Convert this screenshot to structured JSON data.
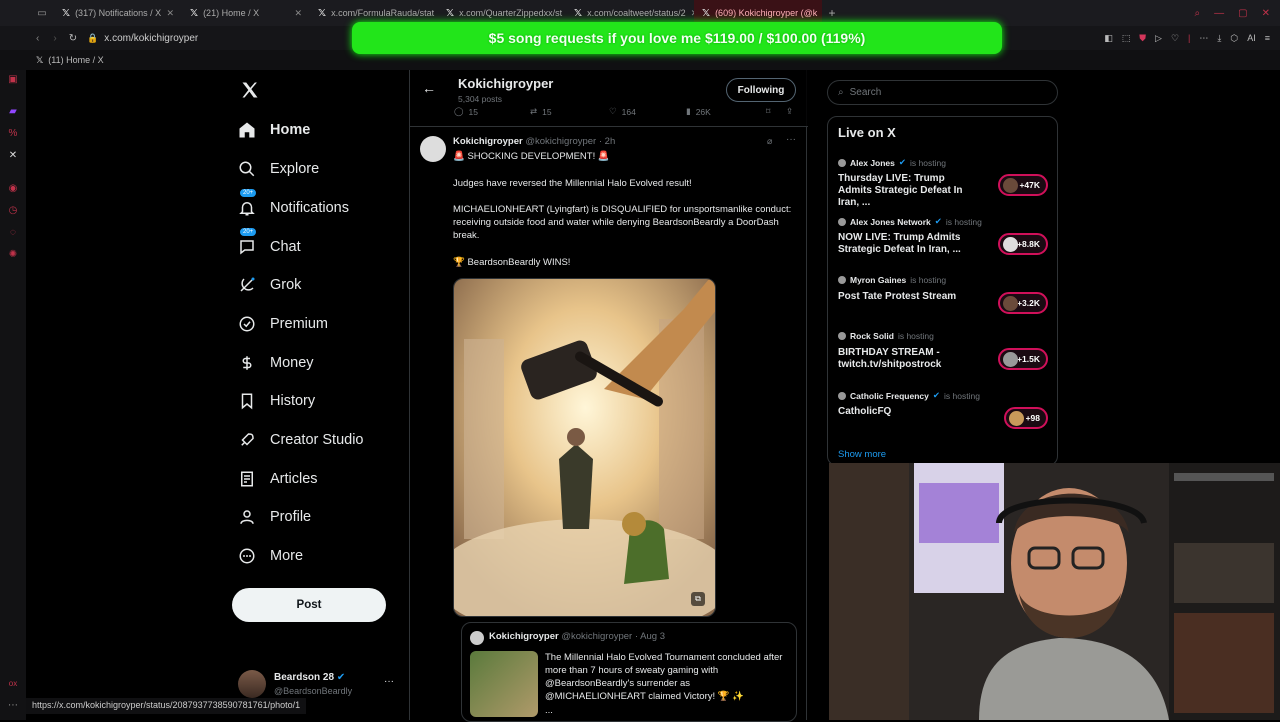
{
  "browser": {
    "tabs": [
      {
        "label": "(317) Notifications / X",
        "active": false
      },
      {
        "label": "(21) Home / X",
        "active": false
      },
      {
        "label": "x.com/FormulaRauda/stat",
        "active": false
      },
      {
        "label": "x.com/QuarterZippedxx/st",
        "active": false
      },
      {
        "label": "x.com/coaltweet/status/2",
        "active": false
      },
      {
        "label": "(609) Kokichigroyper (@k",
        "active": true
      }
    ],
    "url": "x.com/kokichigroyper",
    "bookmark": "(11) Home / X",
    "status_url": "https://x.com/kokichigroyper/status/2087937738590781761/photo/1",
    "ai_label": "AI"
  },
  "donation_banner": "$5 song requests if you love me $119.00 / $100.00 (119%)",
  "nav": {
    "items": [
      {
        "label": "Home",
        "icon": "home-icon"
      },
      {
        "label": "Explore",
        "icon": "search-icon"
      },
      {
        "label": "Notifications",
        "icon": "bell-icon",
        "badge": "20+"
      },
      {
        "label": "Chat",
        "icon": "chat-icon",
        "badge": "20+"
      },
      {
        "label": "Grok",
        "icon": "grok-icon"
      },
      {
        "label": "Premium",
        "icon": "premium-icon"
      },
      {
        "label": "Money",
        "icon": "money-icon"
      },
      {
        "label": "History",
        "icon": "bookmark-icon"
      },
      {
        "label": "Creator Studio",
        "icon": "rocket-icon"
      },
      {
        "label": "Articles",
        "icon": "articles-icon"
      },
      {
        "label": "Profile",
        "icon": "profile-icon"
      },
      {
        "label": "More",
        "icon": "more-icon"
      }
    ],
    "post_label": "Post",
    "account": {
      "name": "Beardson 28",
      "handle": "@BeardsonBeardly"
    }
  },
  "header": {
    "name": "Kokichigroyper",
    "posts": "5,304 posts",
    "follow_label": "Following",
    "stats": {
      "replies": "15",
      "reposts": "15",
      "likes": "164",
      "views": "26K"
    }
  },
  "tweet": {
    "author": "Kokichigroyper",
    "handle": "@kokichigroyper",
    "time": "· 2h",
    "line1": "🚨 SHOCKING DEVELOPMENT! 🚨",
    "line2": "Judges have reversed the Millennial Halo Evolved result!",
    "line3": "MICHAELIONHEART (Lyingfart) is DISQUALIFIED for unsportsmanlike conduct: receiving outside food and water while denying BeardsonBeardly a DoorDash break.",
    "line4": "🏆 BeardsonBeardly WINS!"
  },
  "quote": {
    "author": "Kokichigroyper",
    "handle": "@kokichigroyper",
    "time": "· Aug 3",
    "text": "The Millennial Halo Evolved Tournament concluded after more than 7 hours of sweaty gaming with @BeardsonBeardly's surrender as @MICHAELIONHEART claimed Victory! 🏆 ✨",
    "ellipsis": "..."
  },
  "right": {
    "search_placeholder": "Search",
    "live_title": "Live on X",
    "hosting_label": "is hosting",
    "streams": [
      {
        "host": "Alex Jones",
        "verified": true,
        "title": "Thursday LIVE: Trump Admits Strategic Defeat In Iran, ...",
        "count": "+47K"
      },
      {
        "host": "Alex Jones Network",
        "verified": true,
        "title": "NOW LIVE: Trump Admits Strategic Defeat In Iran, ...",
        "count": "+8.8K"
      },
      {
        "host": "Myron Gaines",
        "verified": false,
        "title": "Post Tate Protest Stream",
        "count": "+3.2K"
      },
      {
        "host": "Rock Solid",
        "verified": false,
        "title": "BIRTHDAY STREAM - twitch.tv/shitpostrock",
        "count": "+1.5K"
      },
      {
        "host": "Catholic Frequency",
        "verified": true,
        "title": "CatholicFQ",
        "count": "+98"
      }
    ],
    "show_more": "Show more"
  },
  "colors": {
    "accent": "#1d9bf0",
    "donation": "#22e51a",
    "live_pill": "#d0105a",
    "opera_red": "#c0324a"
  }
}
